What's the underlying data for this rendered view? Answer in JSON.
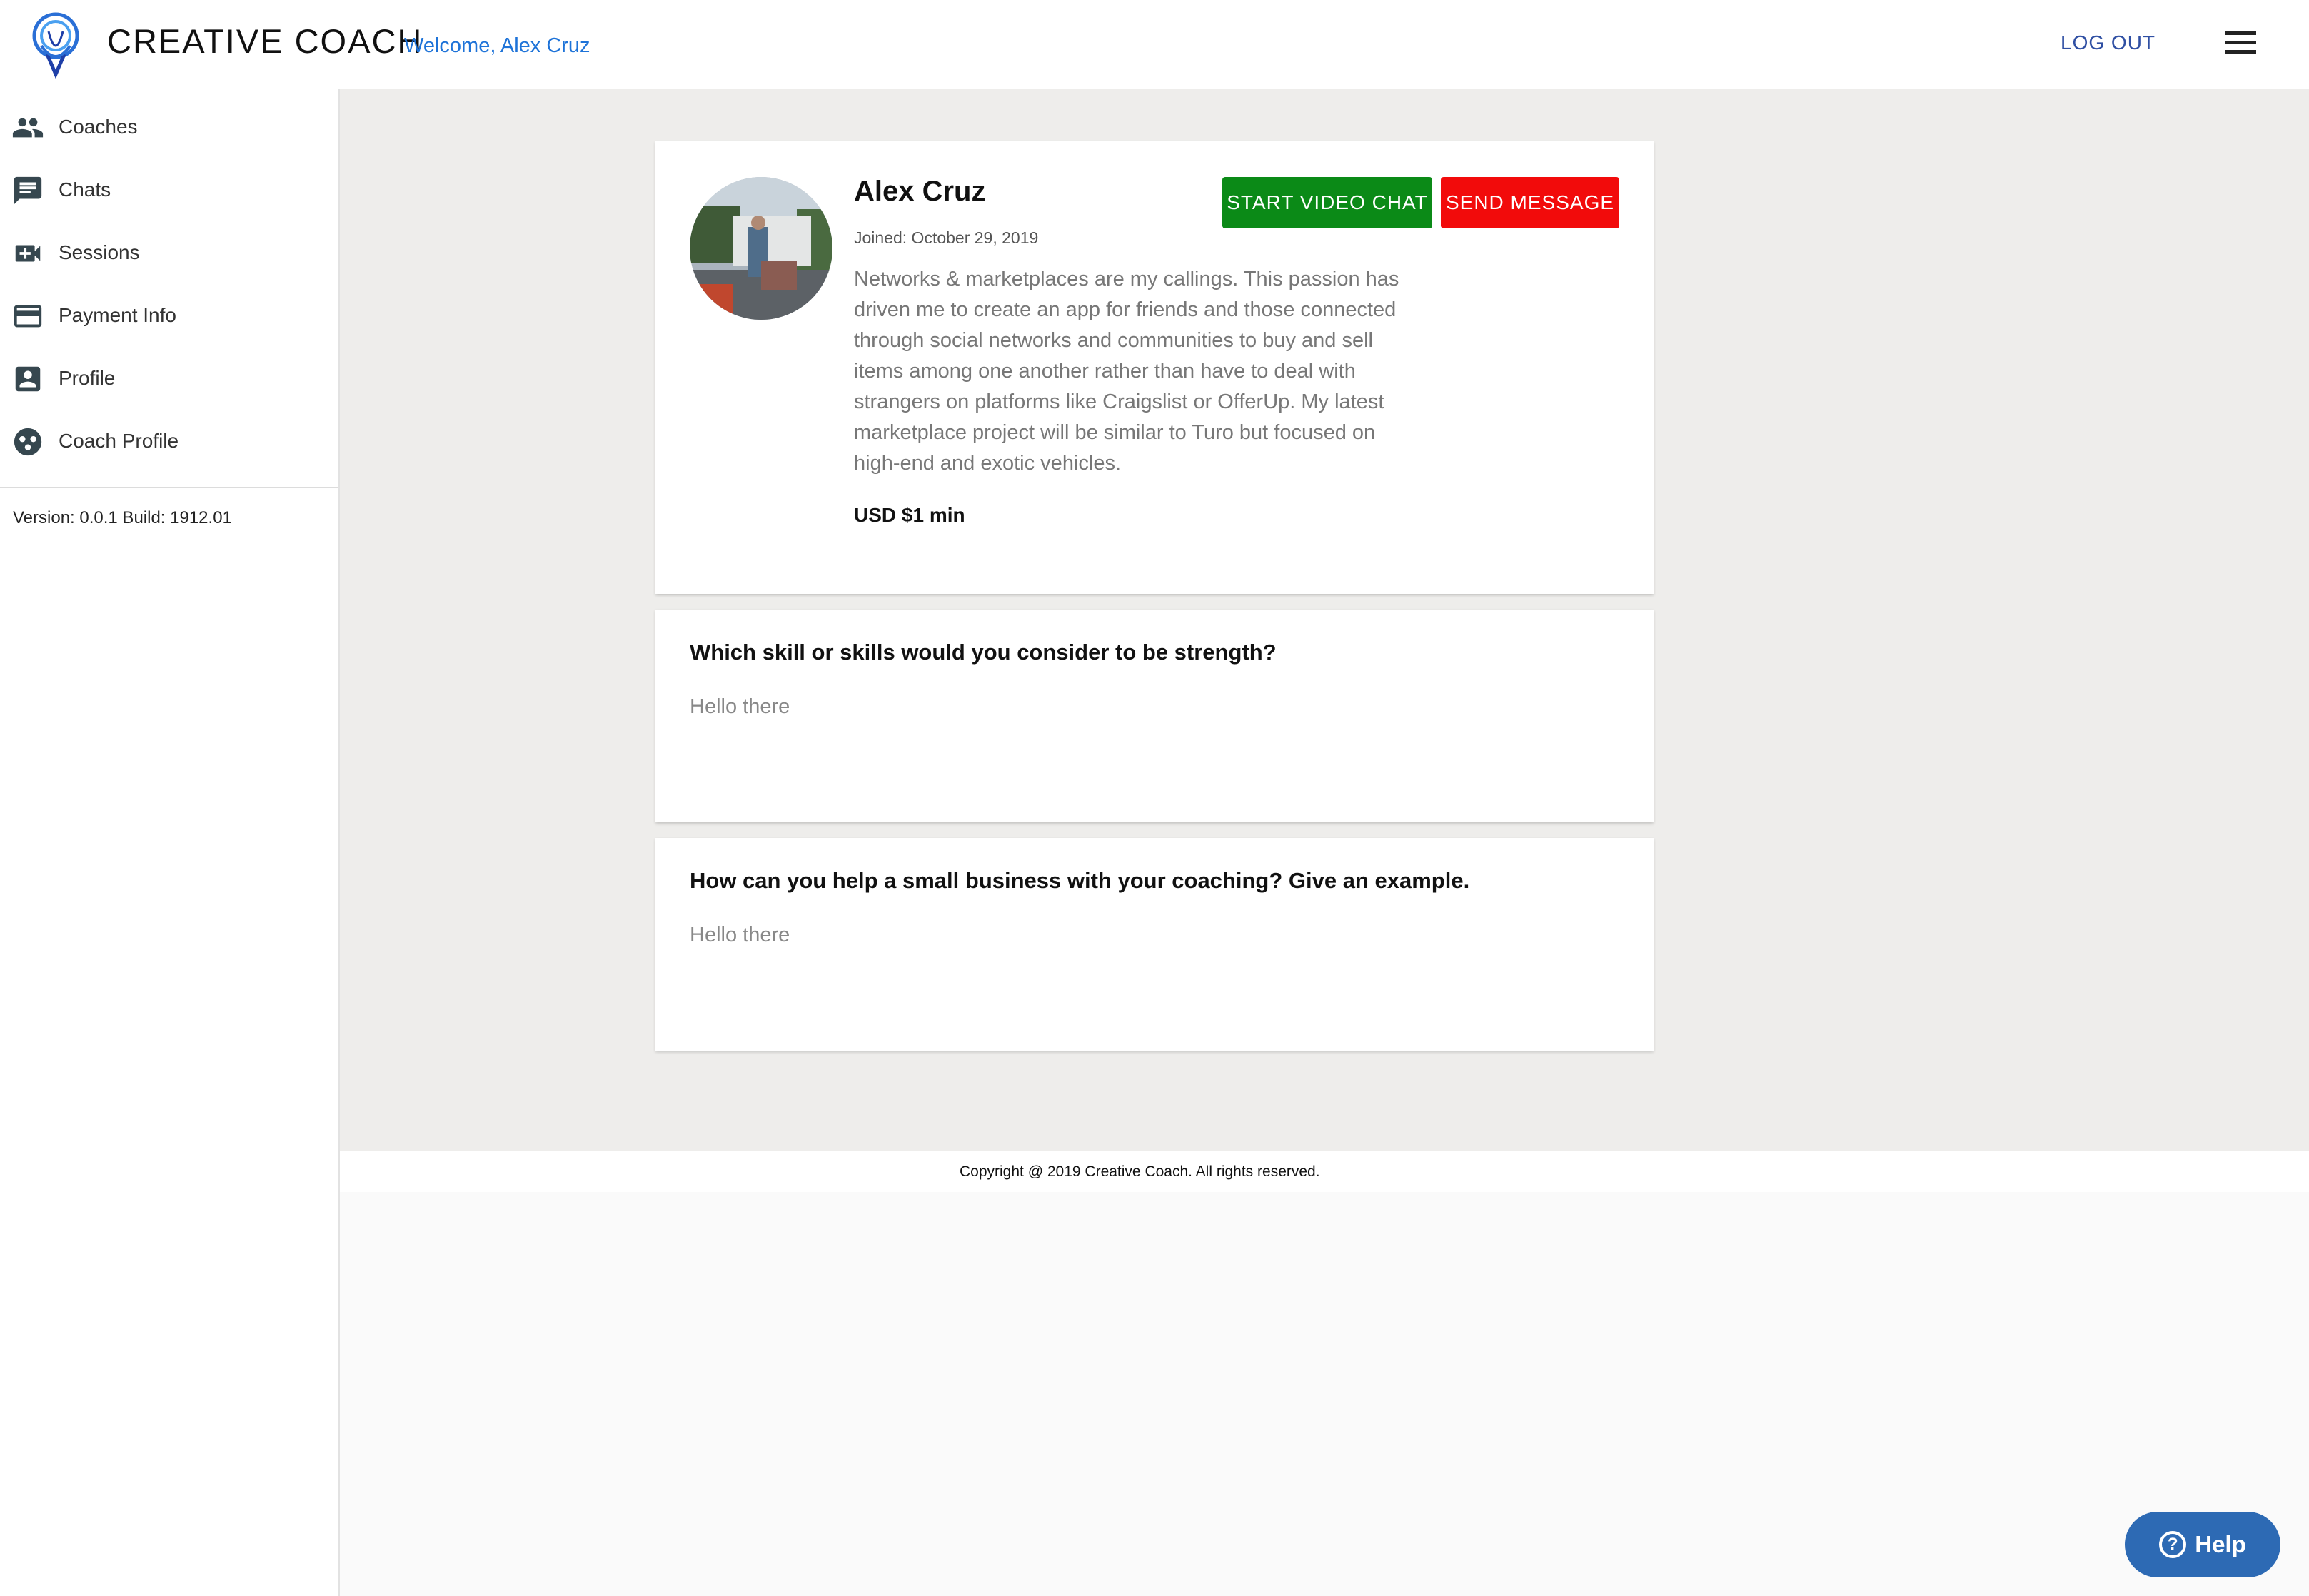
{
  "header": {
    "brand": "CREATIVE COACH",
    "welcome": "Welcome, Alex Cruz",
    "logout_label": "LOG OUT",
    "menu_icon": "hamburger-menu-icon"
  },
  "sidebar": {
    "items": [
      {
        "label": "Coaches",
        "icon": "people-icon"
      },
      {
        "label": "Chats",
        "icon": "chat-icon"
      },
      {
        "label": "Sessions",
        "icon": "video-call-icon"
      },
      {
        "label": "Payment Info",
        "icon": "credit-card-icon"
      },
      {
        "label": "Profile",
        "icon": "account-box-icon"
      },
      {
        "label": "Coach Profile",
        "icon": "group-circle-icon"
      }
    ],
    "version": "Version: 0.0.1 Build: 1912.01"
  },
  "profile": {
    "name": "Alex Cruz",
    "joined": "Joined: October 29, 2019",
    "bio": "Networks & marketplaces are my callings. This passion has driven me to create an app for friends and those connected through social networks and communities to buy and sell items among one another rather than have to deal with strangers on platforms like Craigslist or OfferUp. My latest marketplace project will be similar to Turo but focused on high-end and exotic vehicles.",
    "rate": "USD $1 min",
    "video_chat_label": "START VIDEO CHAT",
    "send_message_label": "SEND MESSAGE"
  },
  "questions": [
    {
      "question": "Which skill or skills would you consider to be strength?",
      "answer": "Hello there"
    },
    {
      "question": "How can you help a small business with your coaching? Give an example.",
      "answer": "Hello there"
    }
  ],
  "footer": {
    "copyright": "Copyright @ 2019 Creative Coach. All rights reserved."
  },
  "help": {
    "label": "Help"
  },
  "colors": {
    "accent": "#1e73d8",
    "video_button": "#0b8a17",
    "message_button": "#f20b0b",
    "help_button": "#2d6ab4",
    "main_background": "#eeedeb"
  }
}
